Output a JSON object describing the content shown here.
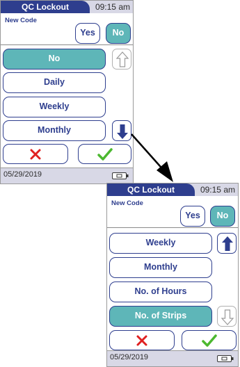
{
  "screen1": {
    "title": "QC Lockout",
    "time": "09:15 am",
    "field_label": "New Code",
    "yes_label": "Yes",
    "no_label": "No",
    "options": [
      "No",
      "Daily",
      "Weekly",
      "Monthly"
    ],
    "selected_option": "No",
    "scroll_up_enabled": false,
    "scroll_down_enabled": true,
    "cancel_icon": "x-icon",
    "confirm_icon": "checkmark-icon",
    "date": "05/29/2019"
  },
  "screen2": {
    "title": "QC Lockout",
    "time": "09:15 am",
    "field_label": "New Code",
    "yes_label": "Yes",
    "no_label": "No",
    "options": [
      "Weekly",
      "Monthly",
      "No. of Hours",
      "No. of Strips"
    ],
    "selected_option": "No. of Strips",
    "scroll_up_enabled": true,
    "scroll_down_enabled": false,
    "cancel_icon": "x-icon",
    "confirm_icon": "checkmark-icon",
    "date": "05/29/2019"
  },
  "colors": {
    "header_blue": "#2e3e8e",
    "selected_teal": "#5eb6b8",
    "cancel_red": "#e02020",
    "confirm_green": "#4cb830",
    "bar_gray": "#d8d8e6"
  }
}
